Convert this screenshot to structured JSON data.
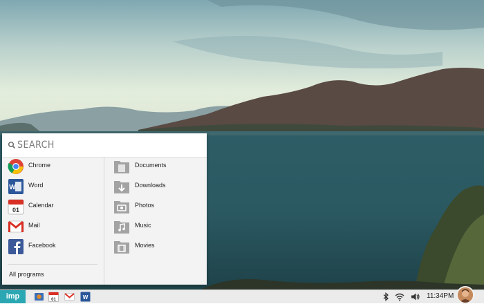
{
  "search": {
    "placeholder": "SEARCH"
  },
  "apps": [
    {
      "label": "Chrome",
      "icon": "chrome-icon"
    },
    {
      "label": "Word",
      "icon": "word-icon"
    },
    {
      "label": "Calendar",
      "icon": "calendar-icon",
      "day": "01"
    },
    {
      "label": "Mail",
      "icon": "mail-icon"
    },
    {
      "label": "Facebook",
      "icon": "facebook-icon"
    }
  ],
  "folders": [
    {
      "label": "Documents",
      "icon": "documents-folder-icon"
    },
    {
      "label": "Downloads",
      "icon": "downloads-folder-icon"
    },
    {
      "label": "Photos",
      "icon": "photos-folder-icon"
    },
    {
      "label": "Music",
      "icon": "music-folder-icon"
    },
    {
      "label": "Movies",
      "icon": "movies-folder-icon"
    }
  ],
  "all_programs_label": "All programs",
  "taskbar": {
    "start_label": "imp",
    "pinned": [
      {
        "icon": "files-icon"
      },
      {
        "icon": "calendar-icon",
        "day": "01"
      },
      {
        "icon": "mail-icon"
      },
      {
        "icon": "word-icon"
      }
    ],
    "tray": [
      "bluetooth-icon",
      "wifi-icon",
      "volume-icon"
    ],
    "clock": "11:34PM"
  },
  "colors": {
    "accent": "#2aa7b3",
    "menu_bg": "#f3f3f3",
    "folder_icon": "#9a9a9a"
  }
}
